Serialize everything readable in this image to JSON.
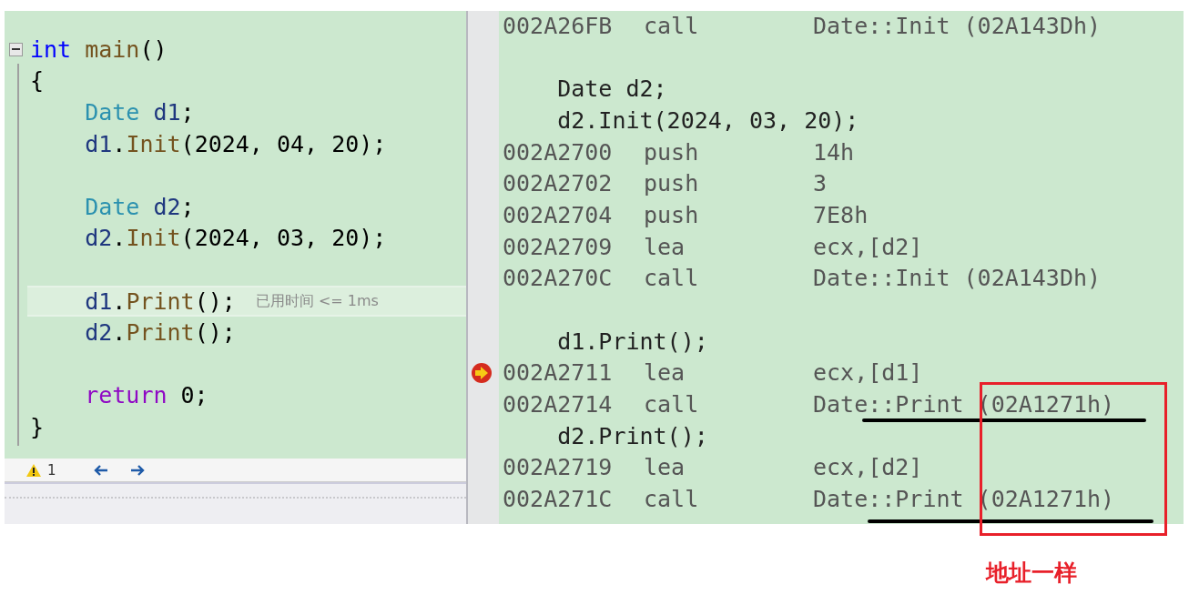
{
  "editor": {
    "lines": [
      {
        "kind": "code",
        "expanded": true,
        "highlighted": false,
        "tokens": [
          {
            "text": "int ",
            "kind": "keyword"
          },
          {
            "text": "main",
            "kind": "func"
          },
          {
            "text": "()",
            "kind": "plain"
          }
        ]
      },
      {
        "kind": "code",
        "highlighted": false,
        "tokens": [
          {
            "text": "{",
            "kind": "plain"
          }
        ]
      },
      {
        "kind": "code",
        "highlighted": false,
        "tokens": [
          {
            "text": "    Date ",
            "kind": "type"
          },
          {
            "text": "d1",
            "kind": "ident"
          },
          {
            "text": ";",
            "kind": "plain"
          }
        ]
      },
      {
        "kind": "code",
        "highlighted": false,
        "tokens": [
          {
            "text": "    d1",
            "kind": "ident"
          },
          {
            "text": ".",
            "kind": "plain"
          },
          {
            "text": "Init",
            "kind": "func"
          },
          {
            "text": "(2024, 04, 20);",
            "kind": "plain"
          }
        ]
      },
      {
        "kind": "blank"
      },
      {
        "kind": "code",
        "highlighted": false,
        "tokens": [
          {
            "text": "    Date ",
            "kind": "type"
          },
          {
            "text": "d2",
            "kind": "ident"
          },
          {
            "text": ";",
            "kind": "plain"
          }
        ]
      },
      {
        "kind": "code",
        "highlighted": false,
        "tokens": [
          {
            "text": "    d2",
            "kind": "ident"
          },
          {
            "text": ".",
            "kind": "plain"
          },
          {
            "text": "Init",
            "kind": "func"
          },
          {
            "text": "(2024, 03, 20);",
            "kind": "plain"
          }
        ]
      },
      {
        "kind": "blank"
      },
      {
        "kind": "code",
        "highlighted": true,
        "hint": "已用时间 <= 1ms",
        "tokens": [
          {
            "text": "    d1",
            "kind": "ident"
          },
          {
            "text": ".",
            "kind": "plain"
          },
          {
            "text": "Print",
            "kind": "func"
          },
          {
            "text": "();",
            "kind": "plain"
          }
        ]
      },
      {
        "kind": "code",
        "highlighted": false,
        "tokens": [
          {
            "text": "    d2",
            "kind": "ident"
          },
          {
            "text": ".",
            "kind": "plain"
          },
          {
            "text": "Print",
            "kind": "func"
          },
          {
            "text": "();",
            "kind": "plain"
          }
        ]
      },
      {
        "kind": "blank"
      },
      {
        "kind": "code",
        "highlighted": false,
        "tokens": [
          {
            "text": "    return",
            "kind": "control"
          },
          {
            "text": " 0;",
            "kind": "plain"
          }
        ]
      },
      {
        "kind": "code",
        "highlighted": false,
        "tokens": [
          {
            "text": "}",
            "kind": "plain"
          }
        ]
      }
    ]
  },
  "status_bar": {
    "warnings": "1"
  },
  "disassembly": {
    "rows": [
      {
        "kind": "instr",
        "current": false,
        "address": "002A26FB",
        "mnemonic": "call",
        "operand": "Date::Init (02A143Dh)"
      },
      {
        "kind": "blank"
      },
      {
        "kind": "source",
        "text": "    Date d2;"
      },
      {
        "kind": "source",
        "text": "    d2.Init(2024, 03, 20);"
      },
      {
        "kind": "instr",
        "current": false,
        "address": "002A2700",
        "mnemonic": "push",
        "operand": "14h"
      },
      {
        "kind": "instr",
        "current": false,
        "address": "002A2702",
        "mnemonic": "push",
        "operand": "3"
      },
      {
        "kind": "instr",
        "current": false,
        "address": "002A2704",
        "mnemonic": "push",
        "operand": "7E8h"
      },
      {
        "kind": "instr",
        "current": false,
        "address": "002A2709",
        "mnemonic": "lea",
        "operand": "ecx,[d2]"
      },
      {
        "kind": "instr",
        "current": false,
        "address": "002A270C",
        "mnemonic": "call",
        "operand": "Date::Init (02A143Dh)"
      },
      {
        "kind": "blank"
      },
      {
        "kind": "source",
        "text": "    d1.Print();"
      },
      {
        "kind": "instr",
        "current": true,
        "address": "002A2711",
        "mnemonic": "lea",
        "operand": "ecx,[d1]"
      },
      {
        "kind": "instr",
        "current": false,
        "address": "002A2714",
        "mnemonic": "call",
        "operand": "Date::Print (02A1271h)"
      },
      {
        "kind": "source",
        "text": "    d2.Print();"
      },
      {
        "kind": "instr",
        "current": false,
        "address": "002A2719",
        "mnemonic": "lea",
        "operand": "ecx,[d2]"
      },
      {
        "kind": "instr",
        "current": false,
        "address": "002A271C",
        "mnemonic": "call",
        "operand": "Date::Print (02A1271h)"
      }
    ]
  },
  "annotation": {
    "label": "地址一样"
  }
}
